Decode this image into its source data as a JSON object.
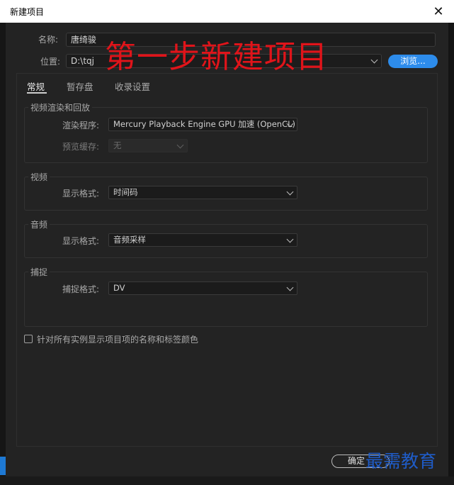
{
  "window": {
    "title": "新建项目"
  },
  "header": {
    "name_label": "名称:",
    "name_value": "唐绮骏",
    "location_label": "位置:",
    "location_value": "D:\\tqj",
    "browse_label": "浏览..."
  },
  "overlay_text": "第一步新建项目",
  "tabs": [
    {
      "label": "常规",
      "active": true
    },
    {
      "label": "暂存盘",
      "active": false
    },
    {
      "label": "收录设置",
      "active": false
    }
  ],
  "groups": {
    "render": {
      "title": "视频渲染和回放",
      "renderer_label": "渲染程序:",
      "renderer_value": "Mercury Playback Engine GPU 加速 (OpenCL)",
      "preview_cache_label": "预览缓存:",
      "preview_cache_value": "无"
    },
    "video": {
      "title": "视频",
      "format_label": "显示格式:",
      "format_value": "时间码"
    },
    "audio": {
      "title": "音频",
      "format_label": "显示格式:",
      "format_value": "音频采样"
    },
    "capture": {
      "title": "捕捉",
      "format_label": "捕捉格式:",
      "format_value": "DV"
    }
  },
  "checkbox": {
    "label": "针对所有实例显示项目项的名称和标签颜色",
    "checked": false
  },
  "footer": {
    "ok_label": "确定"
  },
  "watermark": "最需教育",
  "colors": {
    "accent": "#2d8ceb",
    "overlay_red": "#e0141a",
    "watermark_blue": "#1f5cc8",
    "background": "#232323"
  }
}
